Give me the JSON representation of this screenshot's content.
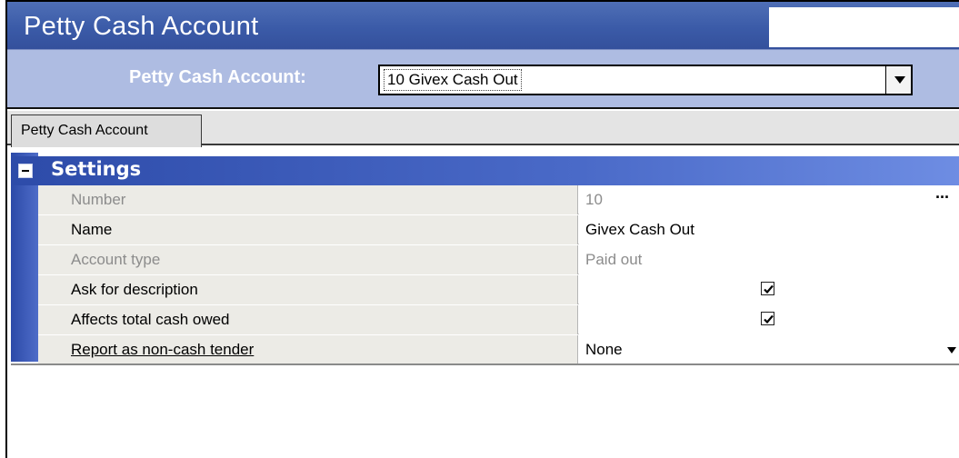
{
  "window": {
    "title": "Petty Cash Account"
  },
  "selector": {
    "label": "Petty Cash Account:",
    "value": "10 Givex Cash Out"
  },
  "tabs": [
    {
      "label": "Petty Cash Account"
    }
  ],
  "settings": {
    "header": "Settings",
    "rows": [
      {
        "name": "Number",
        "value": "10",
        "enabled": false
      },
      {
        "name": "Name",
        "value": "Givex Cash Out",
        "enabled": true
      },
      {
        "name": "Account type",
        "value": "Paid out",
        "enabled": false
      },
      {
        "name": "Ask for description",
        "checked": true,
        "enabled": true
      },
      {
        "name": "Affects total cash owed",
        "checked": true,
        "enabled": true
      },
      {
        "name": "Report as non-cash tender",
        "value": "None",
        "enabled": true
      }
    ]
  },
  "icons": {
    "collapse": "minus-box-icon",
    "ellipsis": "ellipsis-icon",
    "dropdown": "chevron-down-icon",
    "check": "checkmark-icon"
  },
  "colors": {
    "title_bar": "#3b5ba8",
    "selector_band": "#aebce2",
    "settings_header": "#4a6ac8"
  }
}
